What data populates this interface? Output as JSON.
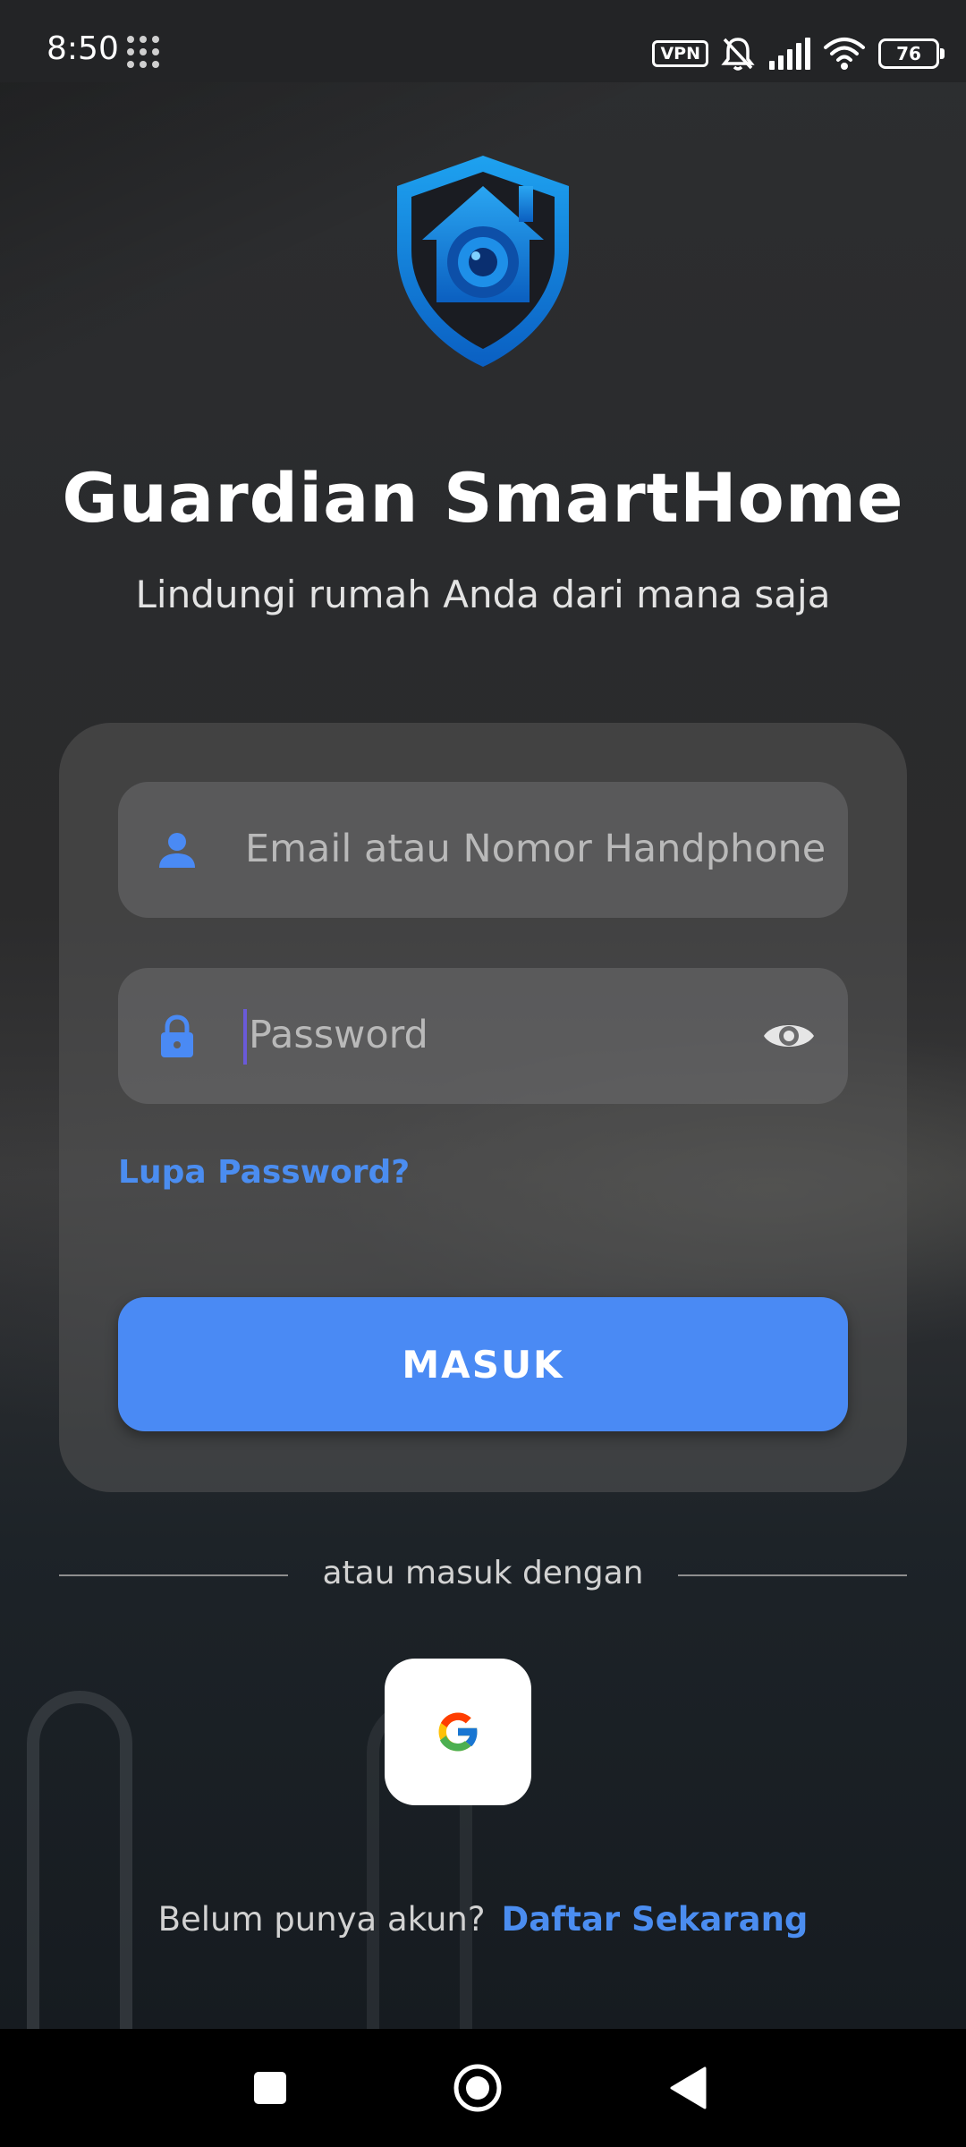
{
  "status_bar": {
    "time": "8:50",
    "vpn_label": "VPN",
    "battery_level": "76",
    "icons": [
      "apps-grid-icon",
      "vpn-icon",
      "bell-off-icon",
      "signal-icon",
      "wifi-icon",
      "battery-icon"
    ]
  },
  "app": {
    "title": "Guardian SmartHome",
    "subtitle": "Lindungi rumah Anda dari mana saja",
    "logo_icon": "shield-home-camera-icon"
  },
  "login_form": {
    "email_placeholder": "Email atau Nomor Handphone",
    "password_placeholder": "Password",
    "forgot_password": "Lupa Password?",
    "submit_label": "MASUK"
  },
  "social_login": {
    "divider_text": "atau masuk dengan",
    "google_icon": "google-icon"
  },
  "signup": {
    "prompt": "Belum punya akun?",
    "link": "Daftar Sekarang"
  },
  "nav_bar": {
    "buttons": [
      "recents-square-icon",
      "home-circle-icon",
      "back-triangle-icon"
    ]
  },
  "colors": {
    "accent": "#4a8af4",
    "link": "#4b8df0",
    "logo_blue": "#1a8fe0"
  }
}
